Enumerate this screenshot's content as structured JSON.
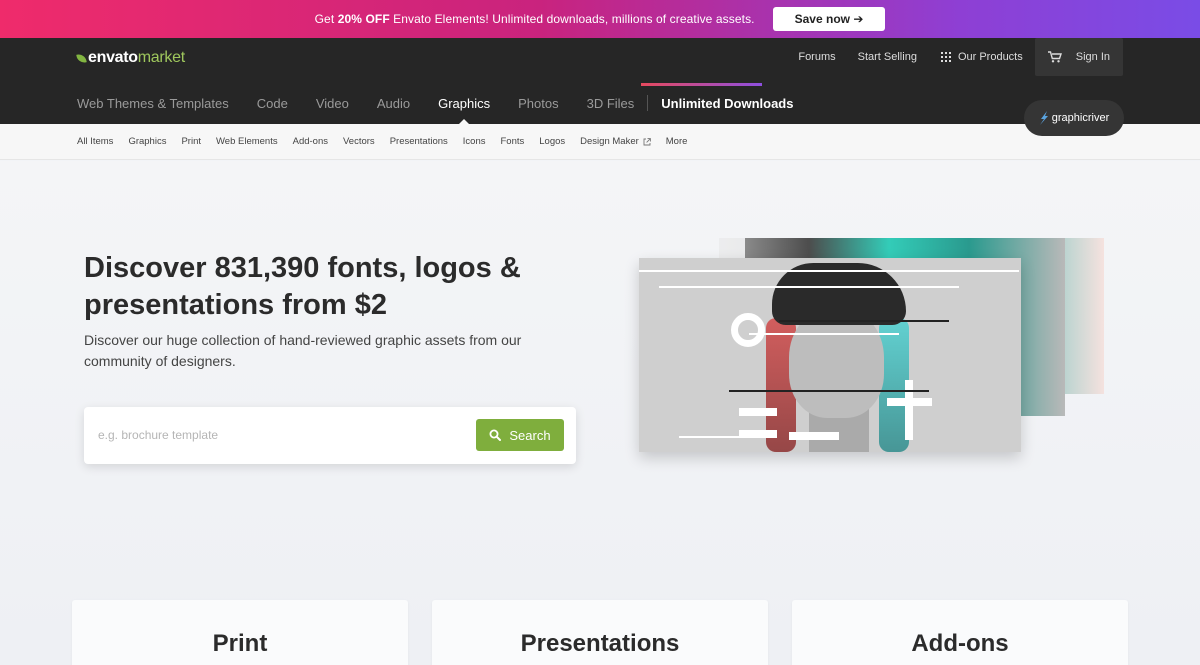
{
  "promo": {
    "text_before": "Get ",
    "text_bold": "20% OFF",
    "text_after": " Envato Elements! Unlimited downloads, millions of creative assets.",
    "button": "Save now ➔"
  },
  "header": {
    "logo_envato": "envato",
    "logo_market": "market",
    "top_links": [
      "Forums",
      "Start Selling"
    ],
    "products_label": "Our Products",
    "signin_label": "Sign In",
    "categories": [
      "Web Themes & Templates",
      "Code",
      "Video",
      "Audio",
      "Graphics",
      "Photos",
      "3D Files"
    ],
    "active_category": "Graphics",
    "unlimited_label": "Unlimited Downloads",
    "badge_label": "graphicriver"
  },
  "subnav": {
    "items": [
      "All Items",
      "Graphics",
      "Print",
      "Web Elements",
      "Add-ons",
      "Vectors",
      "Presentations",
      "Icons",
      "Fonts",
      "Logos",
      "Design Maker",
      "More"
    ]
  },
  "hero": {
    "title": "Discover 831,390 fonts, logos & presentations from $2",
    "subtitle": "Discover our huge collection of hand-reviewed graphic assets from our community of designers.",
    "search_placeholder": "e.g. brochure template",
    "search_button": "Search"
  },
  "cards": [
    "Print",
    "Presentations",
    "Add-ons"
  ],
  "colors": {
    "accent_green": "#7fae3d",
    "header_bg": "#262626",
    "promo_start": "#ef2b6b",
    "promo_end": "#7a4ce6"
  }
}
